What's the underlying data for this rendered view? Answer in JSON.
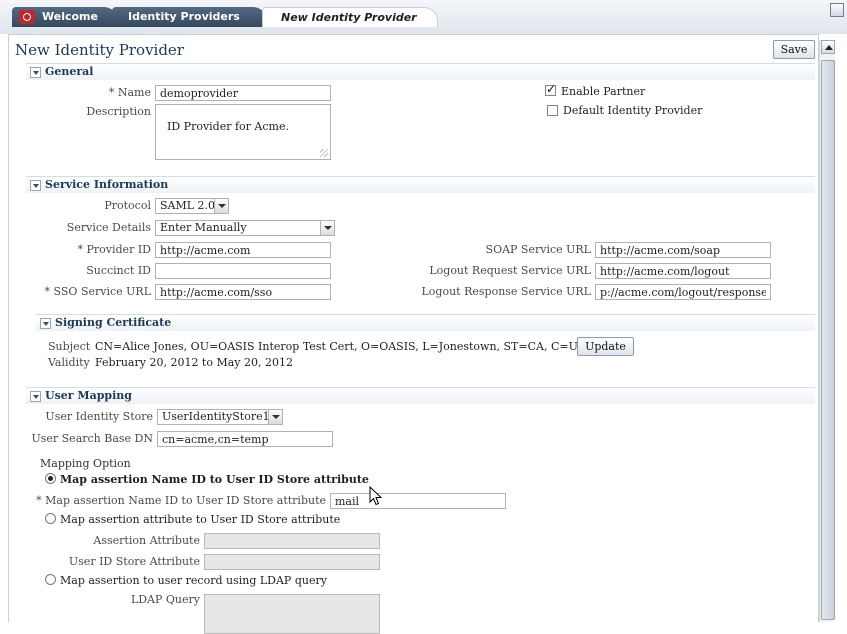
{
  "tabs": [
    {
      "label": "Welcome"
    },
    {
      "label": "Identity Providers"
    },
    {
      "label": "New Identity Provider"
    }
  ],
  "page": {
    "title": "New Identity Provider",
    "save_label": "Save"
  },
  "general": {
    "title": "General",
    "name_label": "Name",
    "name_value": "demoprovider",
    "description_label": "Description",
    "description_value": "ID Provider for Acme.",
    "enable_partner_label": "Enable Partner",
    "enable_partner_checked": true,
    "default_idp_label": "Default Identity Provider",
    "default_idp_checked": false
  },
  "service": {
    "title": "Service Information",
    "protocol_label": "Protocol",
    "protocol_value": "SAML 2.0",
    "details_label": "Service Details",
    "details_value": "Enter Manually",
    "provider_id_label": "Provider ID",
    "provider_id_value": "http://acme.com",
    "succinct_id_label": "Succinct ID",
    "succinct_id_value": "",
    "sso_url_label": "SSO Service URL",
    "sso_url_value": "http://acme.com/sso",
    "soap_url_label": "SOAP Service URL",
    "soap_url_value": "http://acme.com/soap",
    "logout_req_label": "Logout Request Service URL",
    "logout_req_value": "http://acme.com/logout",
    "logout_resp_label": "Logout Response Service URL",
    "logout_resp_value": "p://acme.com/logout/response"
  },
  "signing": {
    "title": "Signing Certificate",
    "subject_label": "Subject",
    "subject_value": "CN=Alice Jones, OU=OASIS Interop Test Cert, O=OASIS, L=Jonestown, ST=CA, C=US",
    "validity_label": "Validity",
    "validity_value": "February 20, 2012 to May 20, 2012",
    "update_label": "Update"
  },
  "mapping": {
    "title": "User Mapping",
    "store_label": "User Identity Store",
    "store_value": "UserIdentityStore1",
    "base_dn_label": "User Search Base DN",
    "base_dn_value": "cn=acme,cn=temp",
    "option_label": "Mapping Option",
    "opt1_label": "Map assertion Name ID to User ID Store attribute",
    "opt1_field_label": "Map assertion Name ID to User ID Store attribute",
    "opt1_field_value": "mail",
    "opt2_label": "Map assertion attribute to User ID Store attribute",
    "assertion_attr_label": "Assertion Attribute",
    "assertion_attr_value": "",
    "store_attr_label": "User ID Store Attribute",
    "store_attr_value": "",
    "opt3_label": "Map assertion to user record using LDAP query",
    "ldap_label": "LDAP Query",
    "ldap_value": ""
  },
  "required_mark": "*"
}
